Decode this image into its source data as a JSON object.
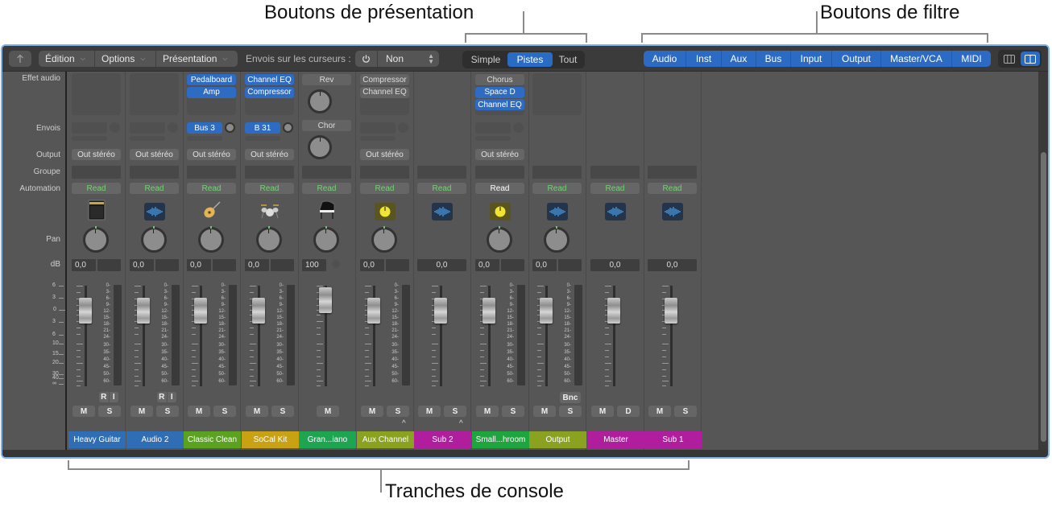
{
  "callouts": {
    "presentation": "Boutons de présentation",
    "filters": "Boutons de filtre",
    "strips": "Tranches de console"
  },
  "toolbar": {
    "back_icon": "back-arrow-icon",
    "menus": [
      "Édition",
      "Options",
      "Présentation"
    ],
    "sends_label": "Envois sur les curseurs :",
    "sends_power_icon": "power-icon",
    "sends_value": "Non",
    "view_modes": [
      {
        "label": "Simple",
        "active": false
      },
      {
        "label": "Pistes",
        "active": true
      },
      {
        "label": "Tout",
        "active": false
      }
    ],
    "filters": [
      "Audio",
      "Inst",
      "Aux",
      "Bus",
      "Input",
      "Output",
      "Master/VCA",
      "MIDI"
    ],
    "layout_buttons": [
      {
        "icon": "narrow-strips-icon",
        "active": false
      },
      {
        "icon": "wide-strips-icon",
        "active": true
      }
    ]
  },
  "row_labels": {
    "audio_fx": "Effet audio",
    "sends": "Envois",
    "output": "Output",
    "group": "Groupe",
    "automation": "Automation",
    "pan": "Pan",
    "db": "dB"
  },
  "fader_scale": [
    "6",
    "3",
    "0",
    "3",
    "6",
    "10",
    "15",
    "20",
    "30",
    "40",
    "∞"
  ],
  "meter_scale": [
    "0",
    "3",
    "6",
    "9",
    "12",
    "15",
    "18",
    "21",
    "24",
    "30",
    "35",
    "40",
    "45",
    "50",
    "60"
  ],
  "strips": [
    {
      "name": "Heavy Guitar",
      "color": "#2f6db5",
      "plugins": [],
      "send": {
        "label": "",
        "active": false
      },
      "output": "Out stéréo",
      "automation": "Read",
      "automation_white": false,
      "icon": "amp-icon",
      "pan": true,
      "db": "0,0",
      "db_peak": "",
      "meter": true,
      "ri": true,
      "buttons": [
        "M",
        "S"
      ],
      "bnc": false,
      "caret": false
    },
    {
      "name": "Audio 2",
      "color": "#2f6db5",
      "plugins": [],
      "send": {
        "label": "",
        "active": false
      },
      "output": "Out stéréo",
      "automation": "Read",
      "automation_white": false,
      "icon": "waveform-icon",
      "pan": true,
      "db": "0,0",
      "db_peak": "",
      "meter": true,
      "ri": true,
      "buttons": [
        "M",
        "S"
      ],
      "bnc": false,
      "caret": false
    },
    {
      "name": "Classic Clean",
      "color": "#5aa21f",
      "plugins": [
        {
          "label": "Pedalboard",
          "blue": true
        },
        {
          "label": "Amp",
          "blue": true
        }
      ],
      "send": {
        "label": "Bus 3",
        "active": true
      },
      "output": "Out stéréo",
      "automation": "Read",
      "automation_white": false,
      "icon": "guitar-icon",
      "pan": true,
      "db": "0,0",
      "db_peak": "",
      "meter": true,
      "ri": false,
      "buttons": [
        "M",
        "S"
      ],
      "bnc": false,
      "caret": false
    },
    {
      "name": "SoCal Kit",
      "color": "#c8a213",
      "plugins": [
        {
          "label": "Channel EQ",
          "blue": true
        },
        {
          "label": "Compressor",
          "blue": true
        }
      ],
      "send": {
        "label": "B 31",
        "active": true
      },
      "output": "Out stéréo",
      "automation": "Read",
      "automation_white": false,
      "icon": "drums-icon",
      "pan": true,
      "db": "0,0",
      "db_peak": "",
      "meter": true,
      "ri": false,
      "buttons": [
        "M",
        "S"
      ],
      "bnc": false,
      "caret": false
    },
    {
      "name": "Gran...iano",
      "color": "#1ea552",
      "plugins": [
        {
          "label": "Rev",
          "blue": false
        }
      ],
      "send": {
        "label": "Chor",
        "active": false
      },
      "output": "",
      "automation": "Read",
      "automation_white": false,
      "icon": "piano-icon",
      "pan": true,
      "db": "100",
      "db_peak": "",
      "meter": false,
      "ri": false,
      "buttons": [
        "M"
      ],
      "bnc": false,
      "caret": false,
      "knob_strip": true
    },
    {
      "name": "Aux Channel",
      "color": "#8ba221",
      "plugins": [
        {
          "label": "Compressor",
          "blue": false
        },
        {
          "label": "Channel EQ",
          "blue": false
        }
      ],
      "send": {
        "label": "",
        "active": false
      },
      "output": "Out stéréo",
      "automation": "Read",
      "automation_white": false,
      "icon": "aux-knob-icon",
      "pan": true,
      "db": "0,0",
      "db_peak": "",
      "meter": true,
      "ri": false,
      "buttons": [
        "M",
        "S"
      ],
      "bnc": false,
      "caret": true
    },
    {
      "name": "Sub 2",
      "color": "#b01e9e",
      "plugins": null,
      "send": null,
      "output": "",
      "automation": "Read",
      "automation_white": false,
      "icon": "waveform-icon",
      "pan": false,
      "db": "0,0",
      "db_peak": null,
      "meter": false,
      "ri": false,
      "buttons": [
        "M",
        "S"
      ],
      "bnc": false,
      "caret": true
    },
    {
      "name": "Small...hroom",
      "color": "#1ea53e",
      "plugins": [
        {
          "label": "Chorus",
          "blue": false
        },
        {
          "label": "Space D",
          "blue": true
        },
        {
          "label": "Channel EQ",
          "blue": true
        }
      ],
      "send": {
        "label": "",
        "active": false
      },
      "output": "Out stéréo",
      "automation": "Read",
      "automation_white": true,
      "icon": "aux-knob-icon",
      "pan": true,
      "db": "0,0",
      "db_peak": "",
      "meter": true,
      "ri": false,
      "buttons": [
        "M",
        "S"
      ],
      "bnc": false,
      "caret": false
    },
    {
      "name": "Output",
      "color": "#8ba221",
      "plugins": [],
      "send": null,
      "output": "",
      "automation": "Read",
      "automation_white": false,
      "icon": "waveform-icon",
      "pan": true,
      "db": "0,0",
      "db_peak": "",
      "meter": true,
      "ri": false,
      "buttons": [
        "M",
        "S"
      ],
      "bnc": true,
      "caret": false
    },
    {
      "name": "Master",
      "color": "#b01e9e",
      "plugins": null,
      "send": null,
      "output": "",
      "automation": "Read",
      "automation_white": false,
      "icon": "waveform-icon",
      "pan": false,
      "db": "0,0",
      "db_peak": null,
      "meter": false,
      "ri": false,
      "buttons": [
        "M",
        "D"
      ],
      "bnc": false,
      "caret": false
    },
    {
      "name": "Sub 1",
      "color": "#b01e9e",
      "plugins": null,
      "send": null,
      "output": "",
      "automation": "Read",
      "automation_white": false,
      "icon": "waveform-icon",
      "pan": false,
      "db": "0,0",
      "db_peak": null,
      "meter": false,
      "ri": false,
      "buttons": [
        "M",
        "S"
      ],
      "bnc": false,
      "caret": false
    }
  ],
  "bnc_label": "Bnc",
  "ri_labels": [
    "R",
    "I"
  ]
}
